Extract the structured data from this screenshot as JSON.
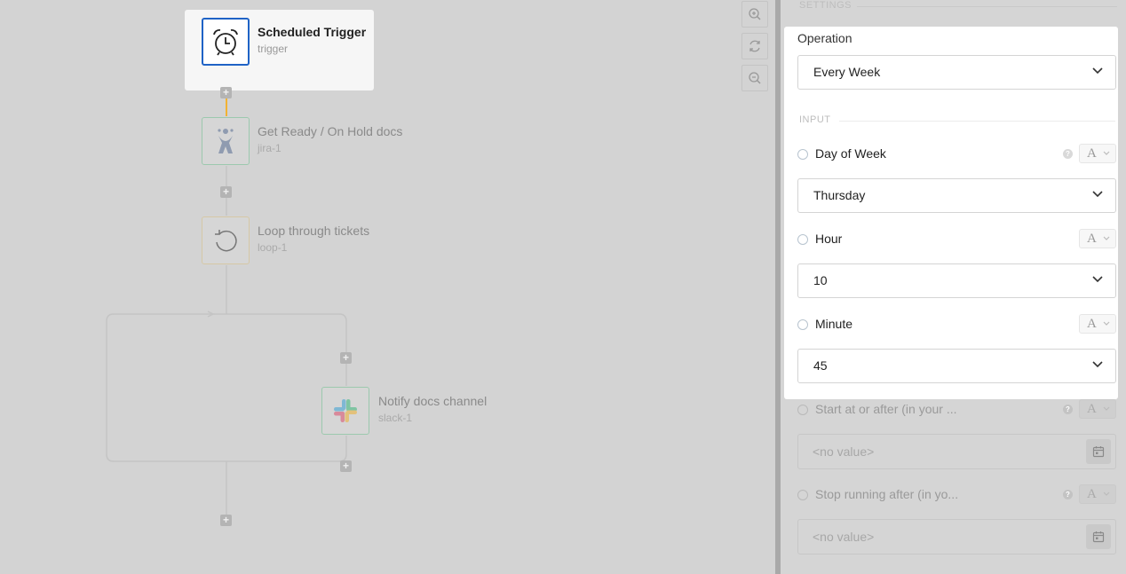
{
  "workflow": {
    "nodes": [
      {
        "title": "Scheduled Trigger",
        "id": "trigger",
        "icon": "alarm-clock-icon",
        "active": true
      },
      {
        "title": "Get Ready / On Hold docs",
        "id": "jira-1",
        "icon": "jira-icon"
      },
      {
        "title": "Loop through tickets",
        "id": "loop-1",
        "icon": "loop-icon"
      },
      {
        "title": "Notify docs channel",
        "id": "slack-1",
        "icon": "slack-icon"
      }
    ],
    "add_step_glyph": "+",
    "connector_color_active": "#f2b233"
  },
  "zoom_controls": [
    "zoom-in-icon",
    "reset-view-icon",
    "zoom-out-icon"
  ],
  "panel": {
    "settings_label": "SETTINGS",
    "operation": {
      "label": "Operation",
      "value": "Every Week"
    },
    "input_label": "INPUT",
    "fields": [
      {
        "label": "Day of Week",
        "value": "Thursday",
        "has_help": true
      },
      {
        "label": "Hour",
        "value": "10"
      },
      {
        "label": "Minute",
        "value": "45"
      }
    ],
    "extra_fields": [
      {
        "label": "Start at or after (in your ...",
        "placeholder": "<no value>"
      },
      {
        "label": "Stop running after (in yo...",
        "placeholder": "<no value>"
      }
    ],
    "type_toggle_glyph": "A",
    "help_glyph": "?"
  },
  "colors": {
    "accent": "#1f63c6",
    "canvas_bg": "#d3d3d3",
    "panel_bg": "#d5d5d5"
  }
}
